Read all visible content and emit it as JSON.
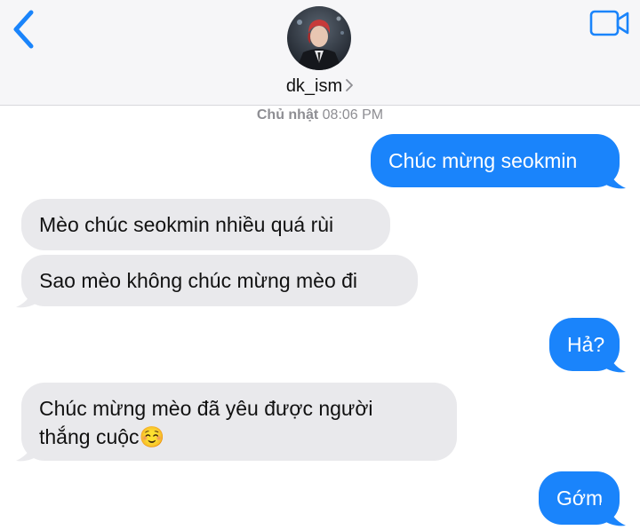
{
  "header": {
    "contact_name": "dk_ism",
    "back_icon": "chevron-left-icon",
    "video_icon": "video-camera-icon",
    "accent_color": "#1a84fb"
  },
  "timestamp": {
    "day": "Chủ nhật",
    "time": "08:06 PM"
  },
  "messages": [
    {
      "sender": "me",
      "text": "Chúc mừng seokmin"
    },
    {
      "sender": "them",
      "text": "Mèo chúc seokmin nhiều quá rùi"
    },
    {
      "sender": "them",
      "text": "Sao mèo không chúc mừng mèo đi"
    },
    {
      "sender": "me",
      "text": "Hả?"
    },
    {
      "sender": "them",
      "text": "Chúc mừng mèo đã yêu được người thắng cuộc☺️",
      "line1": "Chúc mừng mèo đã yêu được người",
      "line2": "thắng cuộc☺️"
    },
    {
      "sender": "me",
      "text": "Gớm"
    }
  ]
}
